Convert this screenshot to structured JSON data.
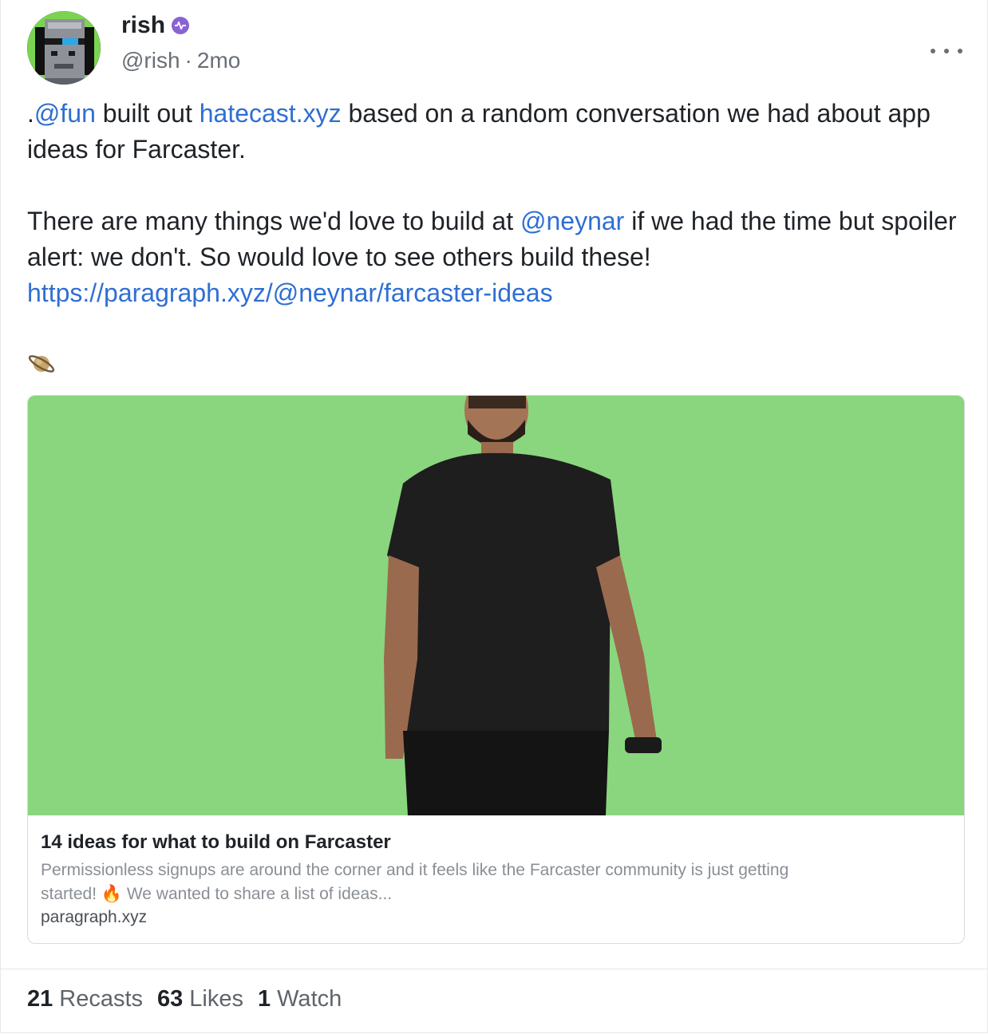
{
  "author": {
    "display_name": "rish",
    "handle": "@rish",
    "separator": "·",
    "time_ago": "2mo",
    "badge_icon": "power-badge-icon",
    "badge_color": "#8a63d2"
  },
  "post": {
    "p1_prefix": ".",
    "p1_mention": "@fun",
    "p1_text1": " built out ",
    "p1_link": "hatecast.xyz",
    "p1_text2": " based on a random conversation we had about app ideas for Farcaster.",
    "p2_text1": "There are many things we'd love to build at ",
    "p2_mention": "@neynar",
    "p2_text2": " if we had the time but spoiler alert: we don't. So would love to see others build these!",
    "p2_url": "https://paragraph.xyz/@neynar/farcaster-ideas",
    "emoji_icon": "ringed-planet-icon",
    "link_color": "#2f6fd3"
  },
  "embed": {
    "title": "14 ideas for what to build on Farcaster",
    "description": "Permissionless signups are around the corner and it feels like the Farcaster community is just getting started! 🔥 We wanted to share a list of ideas...",
    "domain": "paragraph.xyz",
    "image_bg": "#8ad67e"
  },
  "stats": {
    "recasts_count": "21",
    "recasts_label": "Recasts",
    "likes_count": "63",
    "likes_label": "Likes",
    "watch_count": "1",
    "watch_label": "Watch"
  }
}
